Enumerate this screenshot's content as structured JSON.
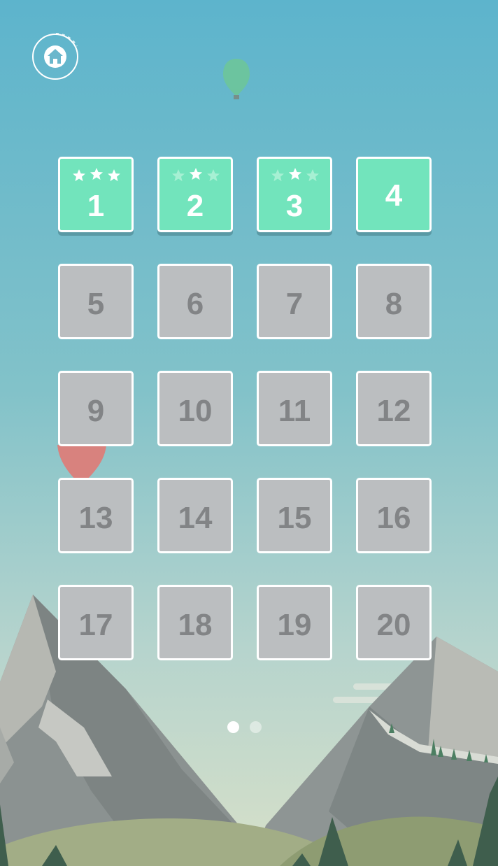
{
  "home_button": {
    "icon": "home-icon"
  },
  "levels": [
    {
      "number": "1",
      "unlocked": true,
      "stars_earned": 3,
      "stars_total": 3
    },
    {
      "number": "2",
      "unlocked": true,
      "stars_earned": 1,
      "stars_total": 3
    },
    {
      "number": "3",
      "unlocked": true,
      "stars_earned": 1,
      "stars_total": 3
    },
    {
      "number": "4",
      "unlocked": true,
      "stars_earned": 0,
      "stars_total": 0
    },
    {
      "number": "5",
      "unlocked": false
    },
    {
      "number": "6",
      "unlocked": false
    },
    {
      "number": "7",
      "unlocked": false
    },
    {
      "number": "8",
      "unlocked": false
    },
    {
      "number": "9",
      "unlocked": false
    },
    {
      "number": "10",
      "unlocked": false
    },
    {
      "number": "11",
      "unlocked": false
    },
    {
      "number": "12",
      "unlocked": false
    },
    {
      "number": "13",
      "unlocked": false
    },
    {
      "number": "14",
      "unlocked": false
    },
    {
      "number": "15",
      "unlocked": false
    },
    {
      "number": "16",
      "unlocked": false
    },
    {
      "number": "17",
      "unlocked": false
    },
    {
      "number": "18",
      "unlocked": false
    },
    {
      "number": "19",
      "unlocked": false
    },
    {
      "number": "20",
      "unlocked": false
    }
  ],
  "pager": {
    "pages": 2,
    "current": 1
  },
  "colors": {
    "sky_top": "#5fb5cb",
    "sky_bottom": "#d6dfcc",
    "tile_unlocked": "#72e4bc",
    "tile_locked": "#bbbec0",
    "number_locked": "#828486",
    "star_filled": "#ffffff",
    "star_empty": "#a6f0d3",
    "balloon_green": "#6fc59a",
    "balloon_red": "#e57a7a"
  }
}
